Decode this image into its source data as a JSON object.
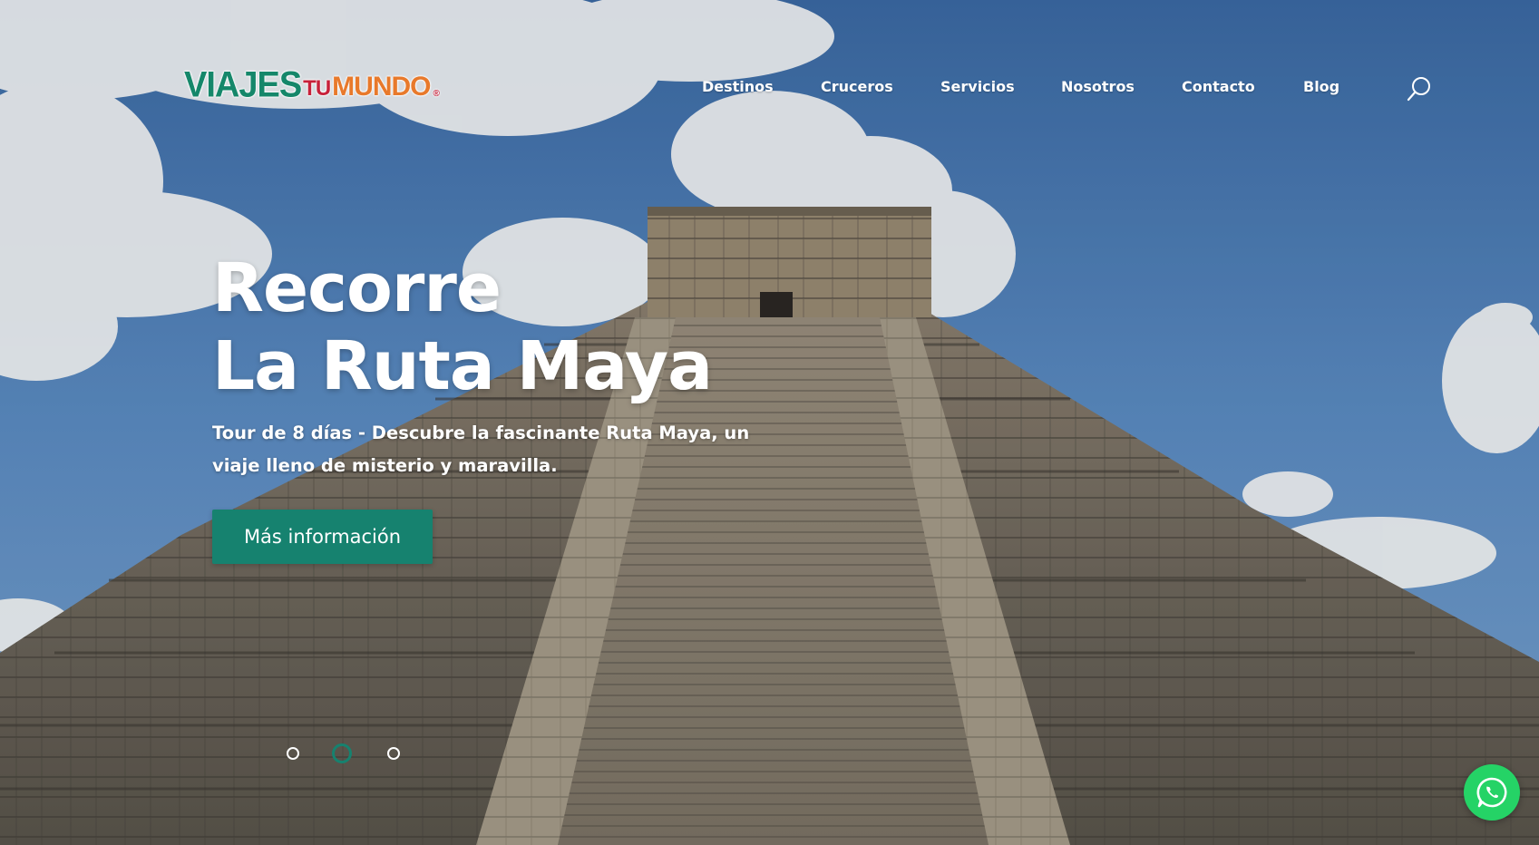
{
  "logo": {
    "part1": "VIAJES",
    "part2": "TU",
    "part3": "MUNDO",
    "mark": "®"
  },
  "nav": {
    "items": [
      {
        "label": "Destinos"
      },
      {
        "label": "Cruceros"
      },
      {
        "label": "Servicios"
      },
      {
        "label": "Nosotros"
      },
      {
        "label": "Contacto"
      },
      {
        "label": "Blog"
      }
    ],
    "search_icon": "search-icon"
  },
  "hero": {
    "title_line1": "Recorre",
    "title_line2": "La Ruta Maya",
    "subtitle": "Tour de 8 días - Descubre la fascinante Ruta Maya, un viaje lleno de misterio y maravilla.",
    "cta_label": "Más información",
    "background": "photo of the Kukulcán pyramid at Chichén Itzá against a cloudy blue sky"
  },
  "slider": {
    "slide_count": 3,
    "active_index": 1
  },
  "whatsapp": {
    "icon": "whatsapp-icon"
  },
  "colors": {
    "accent": "#16826f",
    "whatsapp": "#25d366",
    "logo_green": "#15876a",
    "logo_red": "#c7213a",
    "logo_orange": "#e8792b"
  }
}
